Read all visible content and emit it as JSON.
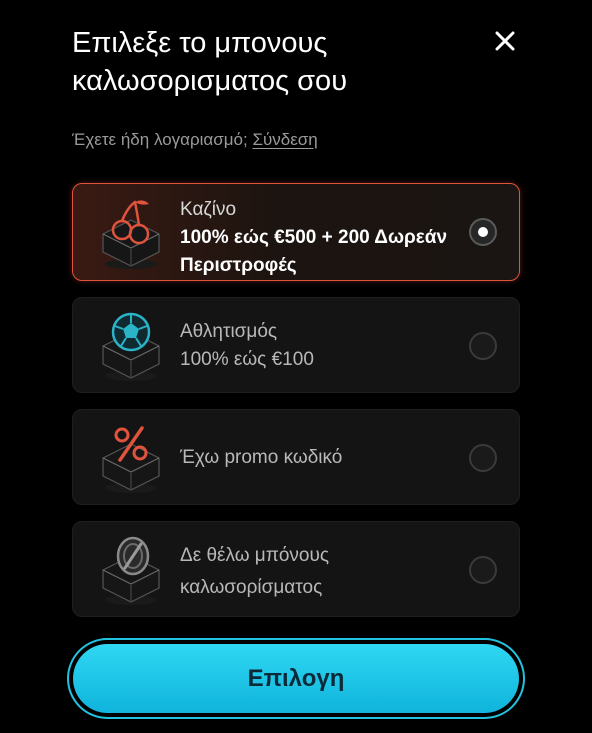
{
  "header": {
    "title": "Επιλεξε το μπονους καλωσορισματος σου",
    "close_icon": "close-icon"
  },
  "login": {
    "prompt": "Έχετε ήδη λογαριασμό;",
    "link": "Σύνδεση"
  },
  "options": [
    {
      "label": "Καζίνο",
      "detail": "100% εώς €500 + 200 Δωρεάν Περιστροφές",
      "icon": "casino-cherries-icon",
      "selected": true
    },
    {
      "label": "Αθλητισμός",
      "detail": "100% εώς €100",
      "icon": "sports-ball-icon",
      "selected": false
    },
    {
      "label": "Έχω promo κωδικό",
      "detail": "",
      "icon": "promo-percent-icon",
      "selected": false
    },
    {
      "label": "Δε θέλω μπόνους καλωσορίσματος",
      "detail": "",
      "icon": "no-bonus-coin-icon",
      "selected": false
    }
  ],
  "submit": {
    "label": "Επιλογη"
  },
  "colors": {
    "background": "#000000",
    "card": "#141414",
    "selected_border": "#e0533d",
    "accent_cyan": "#22c3e0",
    "icon_red": "#e0533d",
    "icon_teal": "#2bb3c8",
    "muted_text": "#9a9a9a"
  }
}
